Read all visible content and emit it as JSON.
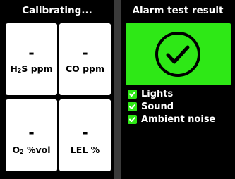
{
  "left": {
    "title": "Calibrating...",
    "sensors": [
      {
        "value": "-",
        "label_main": "H",
        "label_sub": "2",
        "label_rest": "S ppm"
      },
      {
        "value": "-",
        "label_main": "CO ppm",
        "label_sub": "",
        "label_rest": ""
      },
      {
        "value": "-",
        "label_main": "O",
        "label_sub": "2",
        "label_rest": " %vol"
      },
      {
        "value": "-",
        "label_main": "LEL %",
        "label_sub": "",
        "label_rest": ""
      }
    ]
  },
  "right": {
    "title": "Alarm test result",
    "result_icon": "check-circle-icon",
    "accent_color": "#2ee816",
    "checks": [
      {
        "label": "Lights",
        "checked": true
      },
      {
        "label": "Sound",
        "checked": true
      },
      {
        "label": "Ambient noise",
        "checked": true
      }
    ]
  }
}
